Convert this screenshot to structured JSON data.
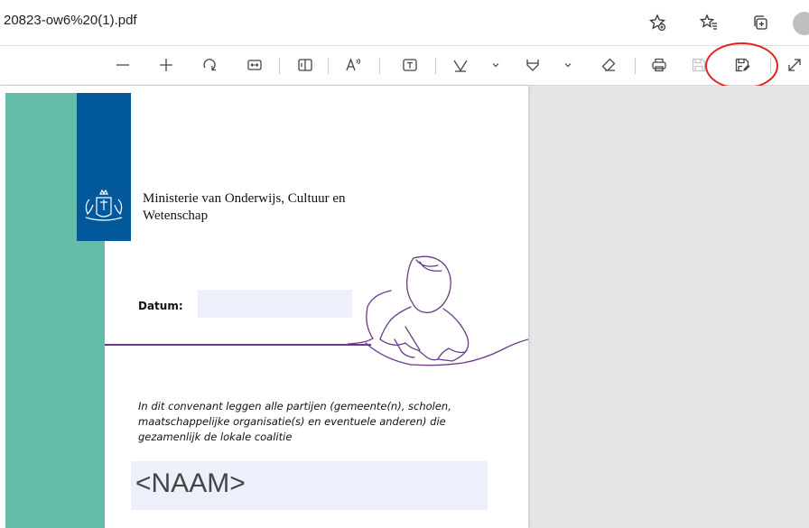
{
  "browser": {
    "url_text": "20823-ow6%20(1).pdf",
    "icons": [
      "favorite-add-icon",
      "favorites-icon",
      "collections-icon",
      "profile-icon"
    ]
  },
  "toolbar": {
    "buttons": [
      "zoom-out-icon",
      "zoom-in-icon",
      "rotate-icon",
      "fit-width-icon",
      "page-view-icon",
      "read-aloud-icon",
      "add-text-icon",
      "draw-icon",
      "draw-dropdown-icon",
      "highlight-icon",
      "highlight-dropdown-icon",
      "erase-icon",
      "print-icon",
      "save-icon",
      "save-as-icon",
      "fullscreen-icon"
    ],
    "annotation_color": "#e02424"
  },
  "document": {
    "ministry_line1": "Ministerie van Onderwijs, Cultuur en",
    "ministry_line2": "Wetenschap",
    "datum_label": "Datum:",
    "datum_value": "",
    "paragraph_line1": "In dit convenant leggen alle partijen (gemeente(n), scholen,",
    "paragraph_line2": "maatschappelijke organisatie(s) en eventuele anderen) die",
    "paragraph_line3": "gezamenlijk de lokale coalitie",
    "naam_placeholder": "<NAAM>",
    "colors": {
      "green": "#65bca8",
      "logo_blue": "#01599b",
      "field_bg": "#edf0fb",
      "purple": "#6b3a86"
    }
  }
}
